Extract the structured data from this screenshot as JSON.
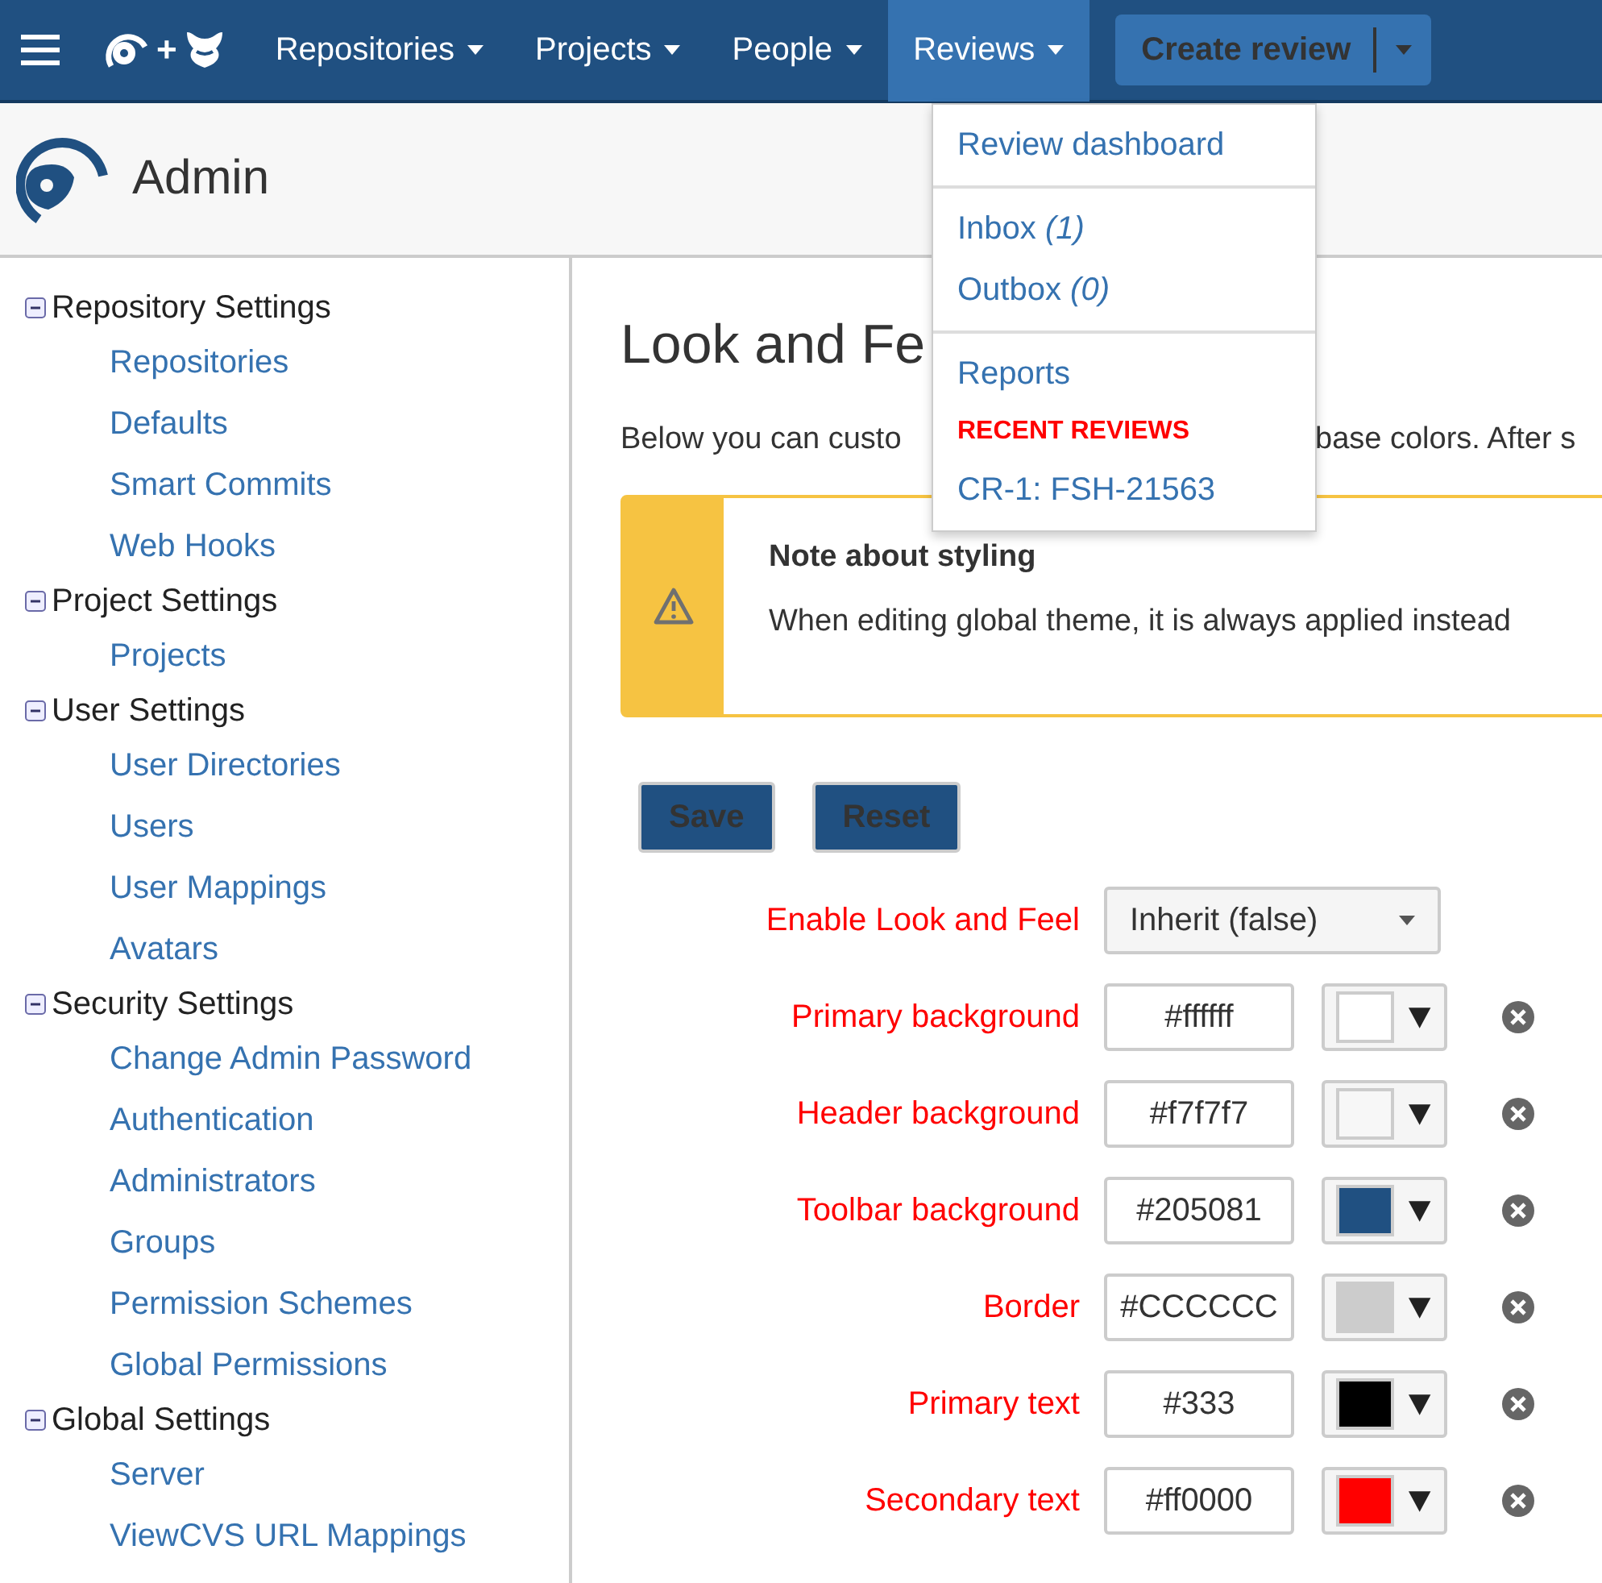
{
  "nav": {
    "joiner": "+",
    "items": [
      {
        "label": "Repositories",
        "selected": false
      },
      {
        "label": "Projects",
        "selected": false
      },
      {
        "label": "People",
        "selected": false
      },
      {
        "label": "Reviews",
        "selected": true
      }
    ],
    "create_button": "Create review"
  },
  "header": {
    "title": "Admin"
  },
  "sidebar": {
    "groups": [
      {
        "label": "Repository Settings",
        "expanded": true,
        "children": [
          "Repositories",
          "Defaults",
          "Smart Commits",
          "Web Hooks"
        ]
      },
      {
        "label": "Project Settings",
        "expanded": true,
        "children": [
          "Projects"
        ]
      },
      {
        "label": "User Settings",
        "expanded": true,
        "children": [
          "User Directories",
          "Users",
          "User Mappings",
          "Avatars"
        ]
      },
      {
        "label": "Security Settings",
        "expanded": true,
        "children": [
          "Change Admin Password",
          "Authentication",
          "Administrators",
          "Groups",
          "Permission Schemes",
          "Global Permissions"
        ]
      },
      {
        "label": "Global Settings",
        "expanded": true,
        "children": [
          "Server",
          "ViewCVS URL Mappings"
        ]
      }
    ]
  },
  "main": {
    "title": "Look and Fe",
    "intro": [
      "Below you can custo",
      "base colors. After s"
    ],
    "note": {
      "title": "Note about styling",
      "text": "When editing global theme, it is always applied instead"
    },
    "buttons": [
      "Save",
      "Reset"
    ],
    "fields": [
      {
        "kind": "select",
        "label": "Enable Look and Feel",
        "value": "Inherit (false)"
      },
      {
        "kind": "color",
        "label": "Primary background",
        "value": "#ffffff",
        "color": "#ffffff"
      },
      {
        "kind": "color",
        "label": "Header background",
        "value": "#f7f7f7",
        "color": "#f7f7f7"
      },
      {
        "kind": "color",
        "label": "Toolbar background",
        "value": "#205081",
        "color": "#205081"
      },
      {
        "kind": "color",
        "label": "Border",
        "value": "#CCCCCC",
        "color": "#cccccc"
      },
      {
        "kind": "color",
        "label": "Primary text",
        "value": "#333",
        "color": "#000000"
      },
      {
        "kind": "color",
        "label": "Secondary text",
        "value": "#ff0000",
        "color": "#ff0000"
      }
    ]
  },
  "reviews_menu": {
    "sections": [
      {
        "items": [
          {
            "kind": "link",
            "text": "Review dashboard"
          }
        ]
      },
      {
        "items": [
          {
            "kind": "link",
            "text": "Inbox *(1)*"
          },
          {
            "kind": "link",
            "text": "Outbox *(0)*"
          }
        ]
      },
      {
        "items": [
          {
            "kind": "link",
            "text": "Reports"
          },
          {
            "kind": "heading",
            "text": "RECENT REVIEWS"
          },
          {
            "kind": "link",
            "text": "CR-1: FSH-21563"
          }
        ]
      }
    ]
  }
}
